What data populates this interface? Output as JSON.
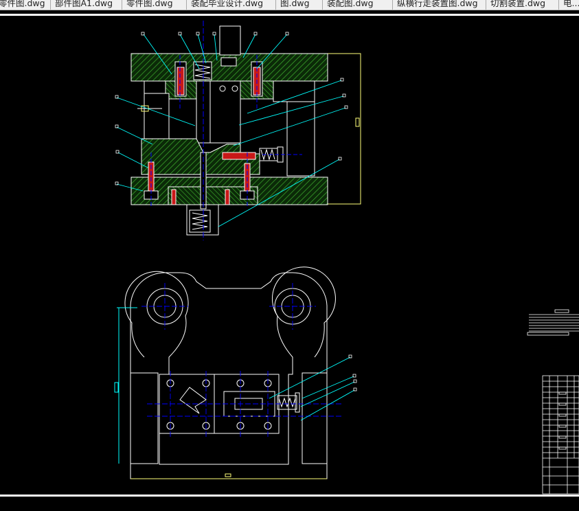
{
  "tabs": [
    {
      "label": "零件图.dwg"
    },
    {
      "label": "部件图A1.dwg"
    },
    {
      "label": "零件图.dwg"
    },
    {
      "label": "装配毕业设计.dwg"
    },
    {
      "label": "图.dwg"
    },
    {
      "label": "装配图.dwg"
    },
    {
      "label": "纵横行走装置图.dwg"
    },
    {
      "label": "切割装置.dwg"
    },
    {
      "label": "电..."
    }
  ],
  "colors": {
    "background": "#000000",
    "hatch": "#39a02a",
    "outline": "#ffffff",
    "leader": "#00ffff",
    "centerline": "#0000ff",
    "border": "#ffff7a",
    "red_part": "#ff2020"
  }
}
